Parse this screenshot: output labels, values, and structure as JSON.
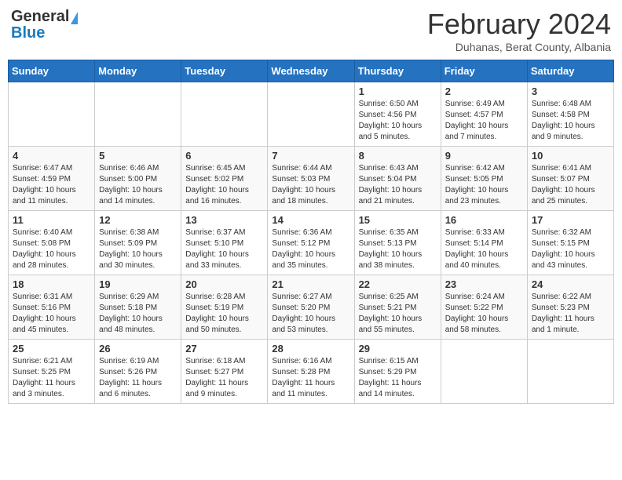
{
  "header": {
    "logo_general": "General",
    "logo_blue": "Blue",
    "month_title": "February 2024",
    "location": "Duhanas, Berat County, Albania"
  },
  "weekdays": [
    "Sunday",
    "Monday",
    "Tuesday",
    "Wednesday",
    "Thursday",
    "Friday",
    "Saturday"
  ],
  "weeks": [
    [
      {
        "day": "",
        "info": ""
      },
      {
        "day": "",
        "info": ""
      },
      {
        "day": "",
        "info": ""
      },
      {
        "day": "",
        "info": ""
      },
      {
        "day": "1",
        "info": "Sunrise: 6:50 AM\nSunset: 4:56 PM\nDaylight: 10 hours and 5 minutes."
      },
      {
        "day": "2",
        "info": "Sunrise: 6:49 AM\nSunset: 4:57 PM\nDaylight: 10 hours and 7 minutes."
      },
      {
        "day": "3",
        "info": "Sunrise: 6:48 AM\nSunset: 4:58 PM\nDaylight: 10 hours and 9 minutes."
      }
    ],
    [
      {
        "day": "4",
        "info": "Sunrise: 6:47 AM\nSunset: 4:59 PM\nDaylight: 10 hours and 11 minutes."
      },
      {
        "day": "5",
        "info": "Sunrise: 6:46 AM\nSunset: 5:00 PM\nDaylight: 10 hours and 14 minutes."
      },
      {
        "day": "6",
        "info": "Sunrise: 6:45 AM\nSunset: 5:02 PM\nDaylight: 10 hours and 16 minutes."
      },
      {
        "day": "7",
        "info": "Sunrise: 6:44 AM\nSunset: 5:03 PM\nDaylight: 10 hours and 18 minutes."
      },
      {
        "day": "8",
        "info": "Sunrise: 6:43 AM\nSunset: 5:04 PM\nDaylight: 10 hours and 21 minutes."
      },
      {
        "day": "9",
        "info": "Sunrise: 6:42 AM\nSunset: 5:05 PM\nDaylight: 10 hours and 23 minutes."
      },
      {
        "day": "10",
        "info": "Sunrise: 6:41 AM\nSunset: 5:07 PM\nDaylight: 10 hours and 25 minutes."
      }
    ],
    [
      {
        "day": "11",
        "info": "Sunrise: 6:40 AM\nSunset: 5:08 PM\nDaylight: 10 hours and 28 minutes."
      },
      {
        "day": "12",
        "info": "Sunrise: 6:38 AM\nSunset: 5:09 PM\nDaylight: 10 hours and 30 minutes."
      },
      {
        "day": "13",
        "info": "Sunrise: 6:37 AM\nSunset: 5:10 PM\nDaylight: 10 hours and 33 minutes."
      },
      {
        "day": "14",
        "info": "Sunrise: 6:36 AM\nSunset: 5:12 PM\nDaylight: 10 hours and 35 minutes."
      },
      {
        "day": "15",
        "info": "Sunrise: 6:35 AM\nSunset: 5:13 PM\nDaylight: 10 hours and 38 minutes."
      },
      {
        "day": "16",
        "info": "Sunrise: 6:33 AM\nSunset: 5:14 PM\nDaylight: 10 hours and 40 minutes."
      },
      {
        "day": "17",
        "info": "Sunrise: 6:32 AM\nSunset: 5:15 PM\nDaylight: 10 hours and 43 minutes."
      }
    ],
    [
      {
        "day": "18",
        "info": "Sunrise: 6:31 AM\nSunset: 5:16 PM\nDaylight: 10 hours and 45 minutes."
      },
      {
        "day": "19",
        "info": "Sunrise: 6:29 AM\nSunset: 5:18 PM\nDaylight: 10 hours and 48 minutes."
      },
      {
        "day": "20",
        "info": "Sunrise: 6:28 AM\nSunset: 5:19 PM\nDaylight: 10 hours and 50 minutes."
      },
      {
        "day": "21",
        "info": "Sunrise: 6:27 AM\nSunset: 5:20 PM\nDaylight: 10 hours and 53 minutes."
      },
      {
        "day": "22",
        "info": "Sunrise: 6:25 AM\nSunset: 5:21 PM\nDaylight: 10 hours and 55 minutes."
      },
      {
        "day": "23",
        "info": "Sunrise: 6:24 AM\nSunset: 5:22 PM\nDaylight: 10 hours and 58 minutes."
      },
      {
        "day": "24",
        "info": "Sunrise: 6:22 AM\nSunset: 5:23 PM\nDaylight: 11 hours and 1 minute."
      }
    ],
    [
      {
        "day": "25",
        "info": "Sunrise: 6:21 AM\nSunset: 5:25 PM\nDaylight: 11 hours and 3 minutes."
      },
      {
        "day": "26",
        "info": "Sunrise: 6:19 AM\nSunset: 5:26 PM\nDaylight: 11 hours and 6 minutes."
      },
      {
        "day": "27",
        "info": "Sunrise: 6:18 AM\nSunset: 5:27 PM\nDaylight: 11 hours and 9 minutes."
      },
      {
        "day": "28",
        "info": "Sunrise: 6:16 AM\nSunset: 5:28 PM\nDaylight: 11 hours and 11 minutes."
      },
      {
        "day": "29",
        "info": "Sunrise: 6:15 AM\nSunset: 5:29 PM\nDaylight: 11 hours and 14 minutes."
      },
      {
        "day": "",
        "info": ""
      },
      {
        "day": "",
        "info": ""
      }
    ]
  ]
}
